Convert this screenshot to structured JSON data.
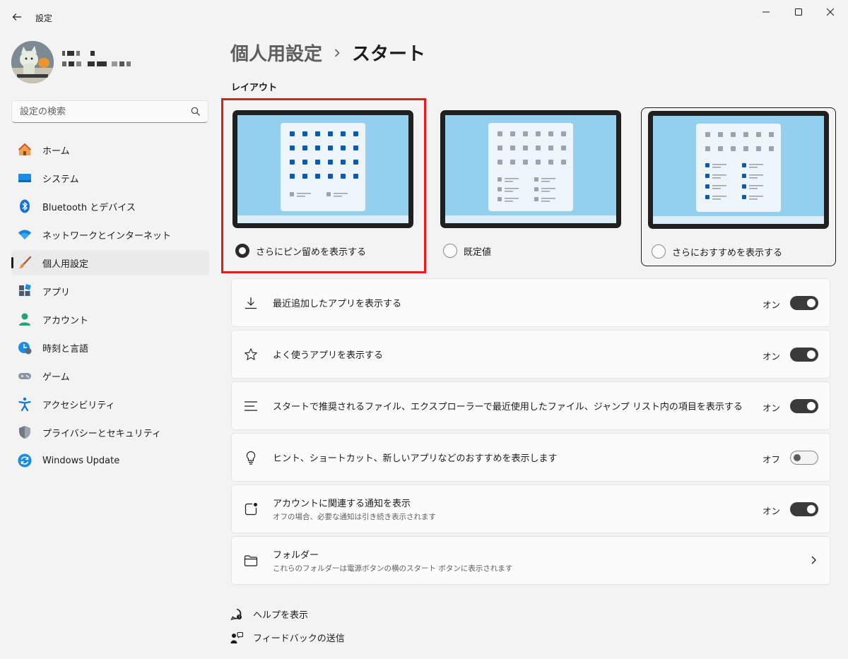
{
  "app": {
    "title": "設定"
  },
  "window": {
    "minimize_icon": "minimize-icon",
    "maximize_icon": "maximize-icon",
    "close_icon": "close-icon"
  },
  "search": {
    "placeholder": "設定の検索",
    "icon": "search-icon"
  },
  "sidebar": {
    "items": [
      {
        "label": "ホーム",
        "icon": "home-icon",
        "active": false
      },
      {
        "label": "システム",
        "icon": "system-icon",
        "active": false
      },
      {
        "label": "Bluetooth とデバイス",
        "icon": "bluetooth-icon",
        "active": false
      },
      {
        "label": "ネットワークとインターネット",
        "icon": "wifi-icon",
        "active": false
      },
      {
        "label": "個人用設定",
        "icon": "brush-icon",
        "active": true
      },
      {
        "label": "アプリ",
        "icon": "apps-icon",
        "active": false
      },
      {
        "label": "アカウント",
        "icon": "account-icon",
        "active": false
      },
      {
        "label": "時刻と言語",
        "icon": "time-language-icon",
        "active": false
      },
      {
        "label": "ゲーム",
        "icon": "gamepad-icon",
        "active": false
      },
      {
        "label": "アクセシビリティ",
        "icon": "accessibility-icon",
        "active": false
      },
      {
        "label": "プライバシーとセキュリティ",
        "icon": "shield-icon",
        "active": false
      },
      {
        "label": "Windows Update",
        "icon": "update-icon",
        "active": false
      }
    ]
  },
  "header": {
    "parent": "個人用設定",
    "current": "スタート"
  },
  "layout": {
    "title": "レイアウト",
    "options": [
      {
        "label": "さらにピン留めを表示する",
        "checked": true
      },
      {
        "label": "既定値",
        "checked": false
      },
      {
        "label": "さらにおすすめを表示する",
        "checked": false
      }
    ]
  },
  "settings": [
    {
      "label": "最近追加したアプリを表示する",
      "state": "オン",
      "on": true,
      "icon": "download-icon"
    },
    {
      "label": "よく使うアプリを表示する",
      "state": "オン",
      "on": true,
      "icon": "star-icon"
    },
    {
      "label": "スタートで推奨されるファイル、エクスプローラーで最近使用したファイル、ジャンプ リスト内の項目を表示する",
      "state": "オン",
      "on": true,
      "icon": "list-icon"
    },
    {
      "label": "ヒント、ショートカット、新しいアプリなどのおすすめを表示します",
      "state": "オフ",
      "on": false,
      "icon": "lightbulb-icon"
    },
    {
      "label": "アカウントに関連する通知を表示",
      "desc": "オフの場合、必要な通知は引き続き表示されます",
      "state": "オン",
      "on": true,
      "icon": "notification-icon"
    },
    {
      "label": "フォルダー",
      "desc": "これらのフォルダーは電源ボタンの横のスタート ボタンに表示されます",
      "icon": "folder-icon"
    }
  ],
  "links": {
    "help": "ヘルプを表示",
    "feedback": "フィードバックの送信"
  },
  "colors": {
    "accent_blue": "#0067c0",
    "selection_red": "#e81b1b",
    "toggle_on": "#3a3a3a",
    "background": "#f3f3f3"
  }
}
